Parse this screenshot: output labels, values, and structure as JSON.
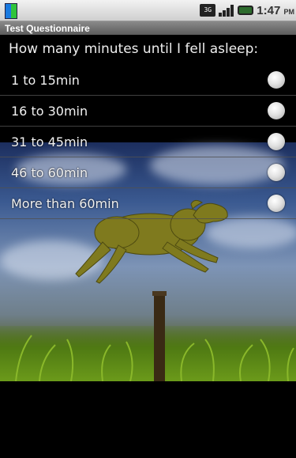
{
  "status_bar": {
    "network_label": "3G",
    "time": "1:47",
    "ampm": "PM"
  },
  "app": {
    "title": "Test Questionnaire"
  },
  "question": {
    "text": "How many minutes until I fell asleep:"
  },
  "options": [
    {
      "label": "1 to 15min",
      "selected": false
    },
    {
      "label": "16 to 30min",
      "selected": false
    },
    {
      "label": "31 to 45min",
      "selected": false
    },
    {
      "label": "46 to 60min",
      "selected": false
    },
    {
      "label": "More than 60min",
      "selected": false
    }
  ],
  "background": {
    "scene": "sheep jumping over fence post"
  }
}
